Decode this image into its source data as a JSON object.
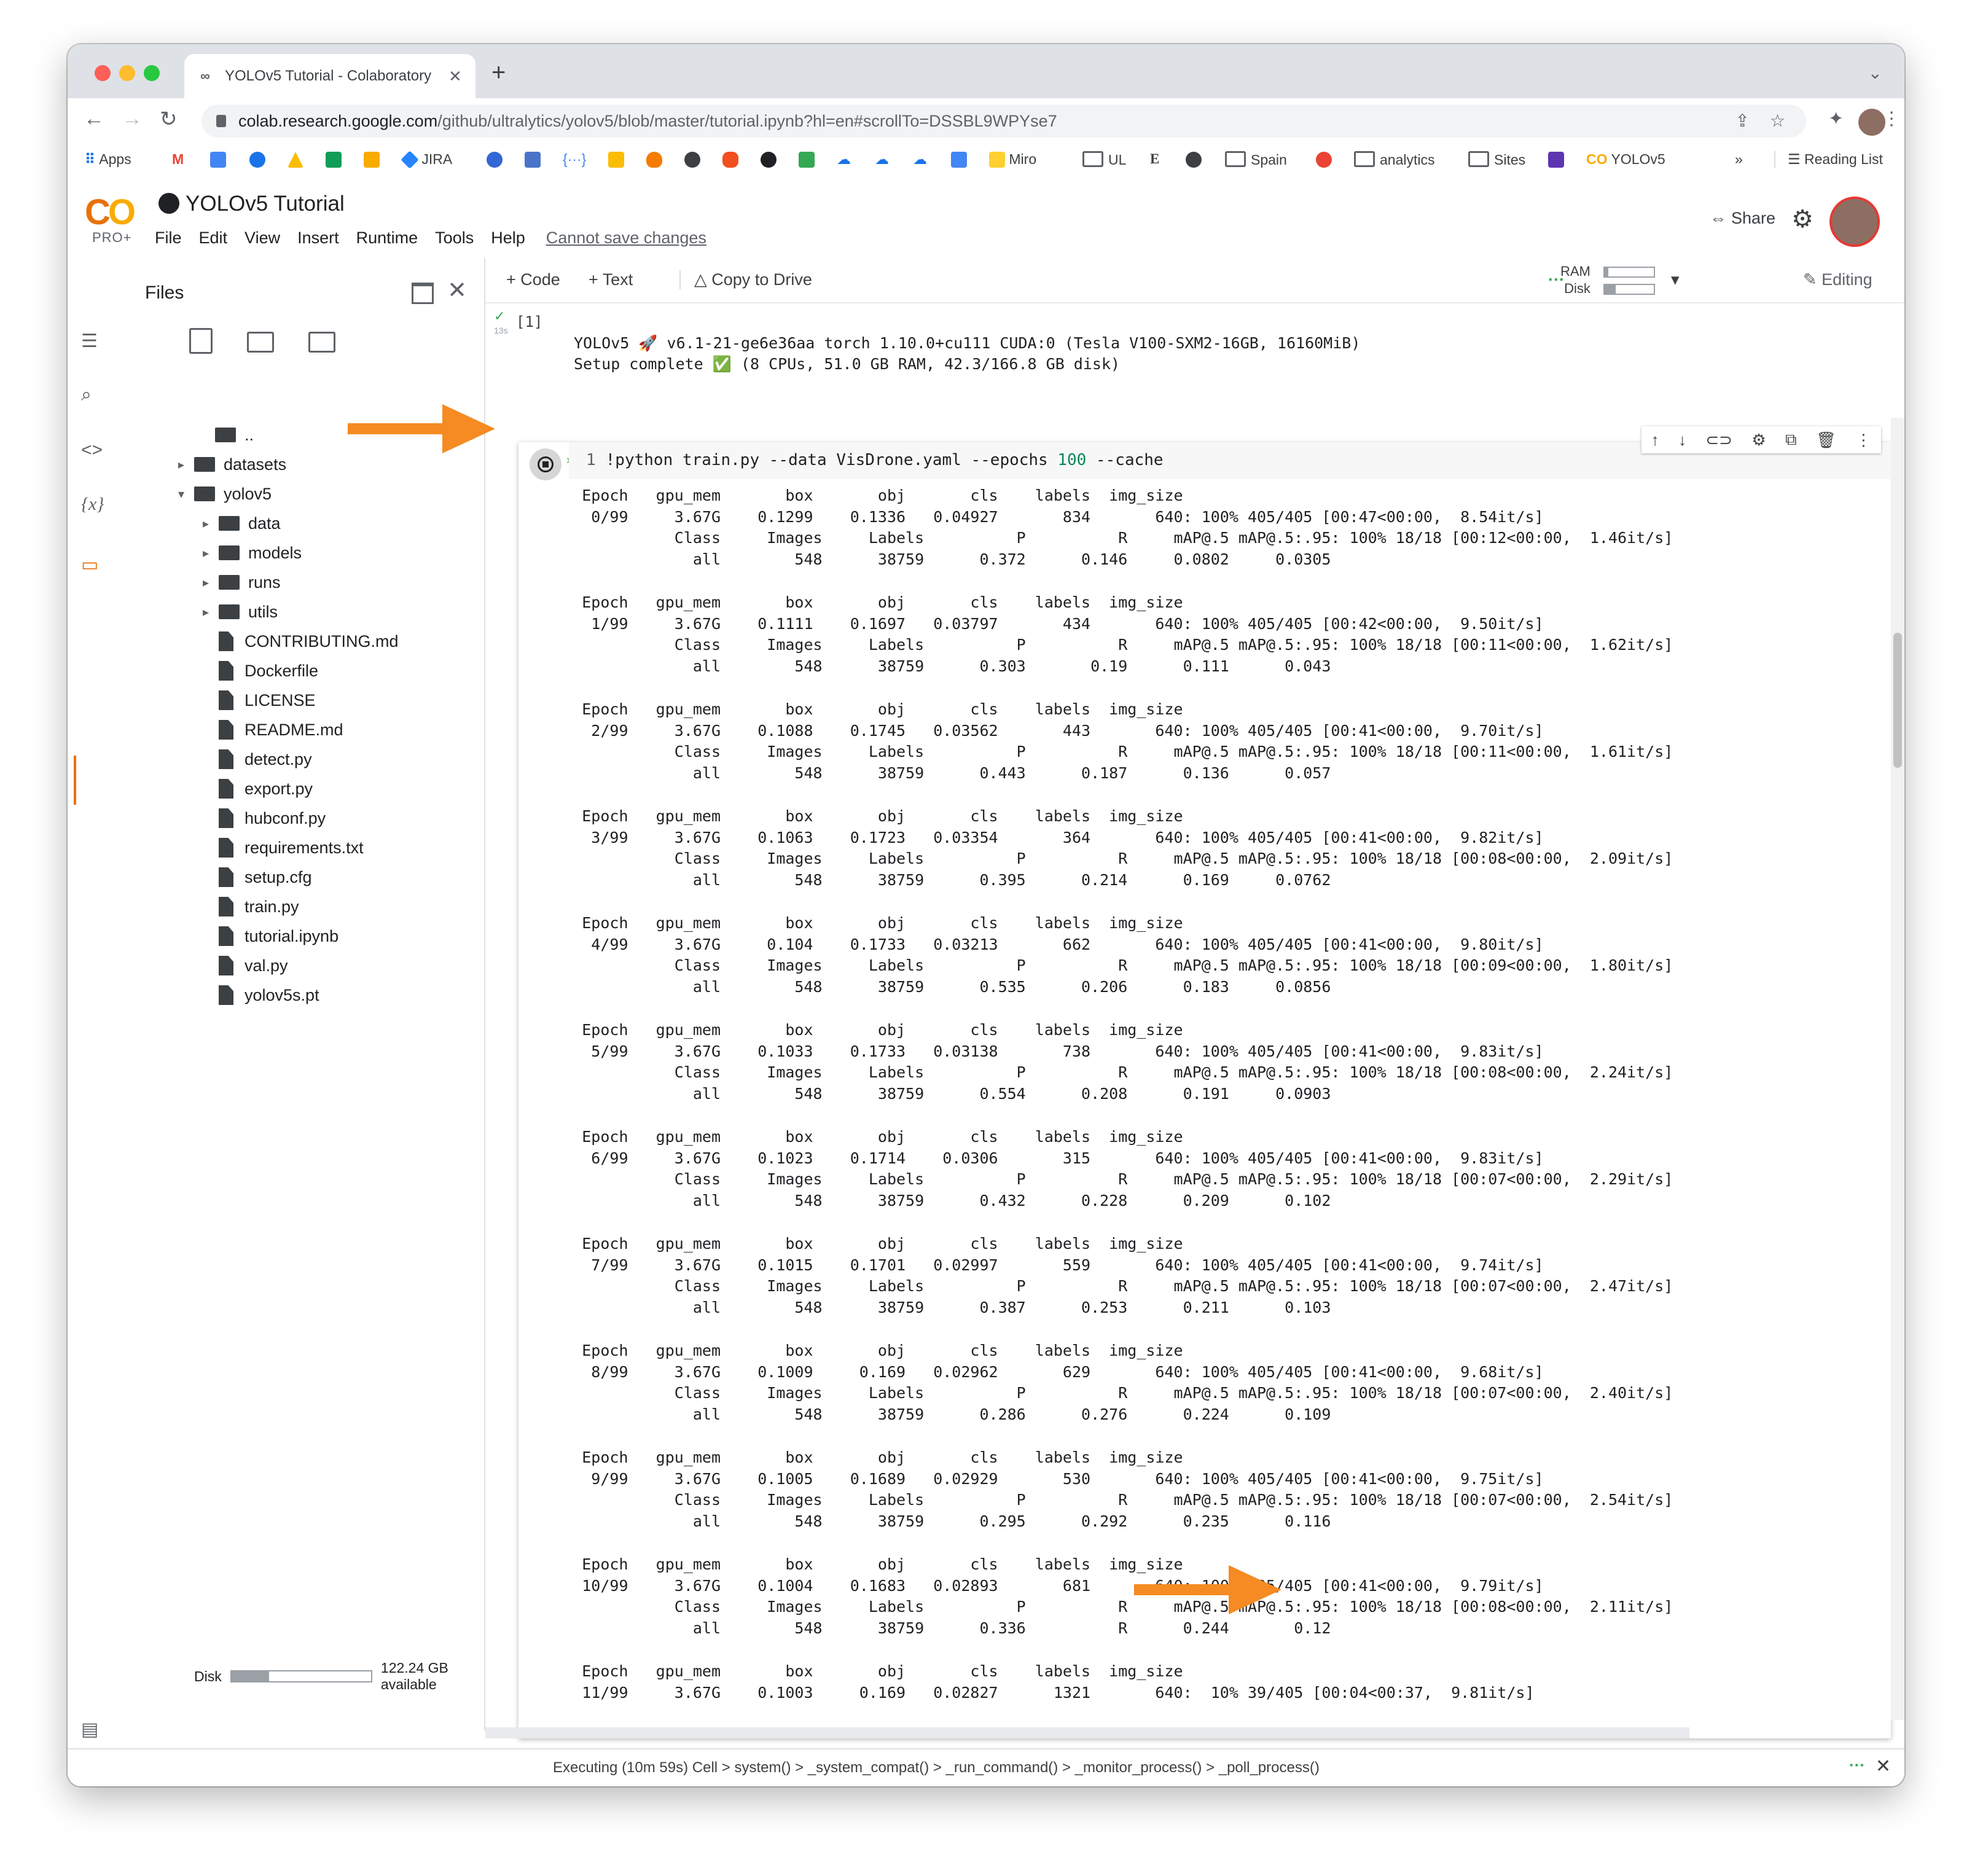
{
  "browser": {
    "tab_title": "YOLOv5 Tutorial - Colaboratory",
    "url_host": "colab.research.google.com",
    "url_path": "/github/ultralytics/yolov5/blob/master/tutorial.ipynb?hl=en#scrollTo=DSSBL9WPYse7",
    "bookmarks": [
      "Apps",
      "JIRA",
      "Miro",
      "UL",
      "Spain",
      "analytics",
      "Sites",
      "YOLOv5"
    ],
    "reading_list": "Reading List",
    "more": "»"
  },
  "colab": {
    "logo": "CO",
    "plan": "PRO+",
    "notebook_title": "YOLOv5 Tutorial",
    "menu": [
      "File",
      "Edit",
      "View",
      "Insert",
      "Runtime",
      "Tools",
      "Help"
    ],
    "cannot_save": "Cannot save changes",
    "share": "Share"
  },
  "toolbar": {
    "code": "+ Code",
    "text": "+ Text",
    "copy_drive": "Copy to Drive",
    "ram": "RAM",
    "disk": "Disk",
    "editing": "Editing",
    "ram_fill": 0.08,
    "disk_fill": 0.22
  },
  "files": {
    "title": "Files",
    "parent": "..",
    "tree": [
      {
        "name": "datasets",
        "type": "folder",
        "depth": 0,
        "caret": "▸"
      },
      {
        "name": "yolov5",
        "type": "folder",
        "depth": 0,
        "caret": "▾"
      },
      {
        "name": "data",
        "type": "folder",
        "depth": 1,
        "caret": "▸"
      },
      {
        "name": "models",
        "type": "folder",
        "depth": 1,
        "caret": "▸"
      },
      {
        "name": "runs",
        "type": "folder",
        "depth": 1,
        "caret": "▸"
      },
      {
        "name": "utils",
        "type": "folder",
        "depth": 1,
        "caret": "▸"
      },
      {
        "name": "CONTRIBUTING.md",
        "type": "file",
        "depth": 1
      },
      {
        "name": "Dockerfile",
        "type": "file",
        "depth": 1
      },
      {
        "name": "LICENSE",
        "type": "file",
        "depth": 1
      },
      {
        "name": "README.md",
        "type": "file",
        "depth": 1
      },
      {
        "name": "detect.py",
        "type": "file",
        "depth": 1
      },
      {
        "name": "export.py",
        "type": "file",
        "depth": 1
      },
      {
        "name": "hubconf.py",
        "type": "file",
        "depth": 1
      },
      {
        "name": "requirements.txt",
        "type": "file",
        "depth": 1
      },
      {
        "name": "setup.cfg",
        "type": "file",
        "depth": 1
      },
      {
        "name": "train.py",
        "type": "file",
        "depth": 1
      },
      {
        "name": "tutorial.ipynb",
        "type": "file",
        "depth": 1
      },
      {
        "name": "val.py",
        "type": "file",
        "depth": 1
      },
      {
        "name": "yolov5s.pt",
        "type": "file",
        "depth": 1
      }
    ],
    "disk_label": "Disk",
    "disk_available": "122.24 GB available",
    "disk_fill": 0.27
  },
  "cell1": {
    "prompt": "[1]",
    "elapsed": "13s",
    "output_lines": [
      "YOLOv5 🚀 v6.1-21-ge6e36aa torch 1.10.0+cu111 CUDA:0 (Tesla V100-SXM2-16GB, 16160MiB)",
      "Setup complete ✅ (8 CPUs, 51.0 GB RAM, 42.3/166.8 GB disk)"
    ]
  },
  "cell2": {
    "line_number": "1",
    "code_prefix": "!python train.py --data VisDrone.yaml --epochs ",
    "code_number": "100",
    "code_suffix": " --cache",
    "output_blocks": [
      [
        "     Epoch   gpu_mem       box       obj       cls    labels  img_size",
        "      0/99     3.67G    0.1299    0.1336   0.04927       834       640: 100% 405/405 [00:47<00:00,  8.54it/s]",
        "               Class     Images     Labels          P          R     mAP@.5 mAP@.5:.95: 100% 18/18 [00:12<00:00,  1.46it/s]",
        "                 all        548      38759      0.372      0.146     0.0802     0.0305"
      ],
      [
        "     Epoch   gpu_mem       box       obj       cls    labels  img_size",
        "      1/99     3.67G    0.1111    0.1697   0.03797       434       640: 100% 405/405 [00:42<00:00,  9.50it/s]",
        "               Class     Images     Labels          P          R     mAP@.5 mAP@.5:.95: 100% 18/18 [00:11<00:00,  1.62it/s]",
        "                 all        548      38759      0.303       0.19      0.111      0.043"
      ],
      [
        "     Epoch   gpu_mem       box       obj       cls    labels  img_size",
        "      2/99     3.67G    0.1088    0.1745   0.03562       443       640: 100% 405/405 [00:41<00:00,  9.70it/s]",
        "               Class     Images     Labels          P          R     mAP@.5 mAP@.5:.95: 100% 18/18 [00:11<00:00,  1.61it/s]",
        "                 all        548      38759      0.443      0.187      0.136      0.057"
      ],
      [
        "     Epoch   gpu_mem       box       obj       cls    labels  img_size",
        "      3/99     3.67G    0.1063    0.1723   0.03354       364       640: 100% 405/405 [00:41<00:00,  9.82it/s]",
        "               Class     Images     Labels          P          R     mAP@.5 mAP@.5:.95: 100% 18/18 [00:08<00:00,  2.09it/s]",
        "                 all        548      38759      0.395      0.214      0.169     0.0762"
      ],
      [
        "     Epoch   gpu_mem       box       obj       cls    labels  img_size",
        "      4/99     3.67G     0.104    0.1733   0.03213       662       640: 100% 405/405 [00:41<00:00,  9.80it/s]",
        "               Class     Images     Labels          P          R     mAP@.5 mAP@.5:.95: 100% 18/18 [00:09<00:00,  1.80it/s]",
        "                 all        548      38759      0.535      0.206      0.183     0.0856"
      ],
      [
        "     Epoch   gpu_mem       box       obj       cls    labels  img_size",
        "      5/99     3.67G    0.1033    0.1733   0.03138       738       640: 100% 405/405 [00:41<00:00,  9.83it/s]",
        "               Class     Images     Labels          P          R     mAP@.5 mAP@.5:.95: 100% 18/18 [00:08<00:00,  2.24it/s]",
        "                 all        548      38759      0.554      0.208      0.191     0.0903"
      ],
      [
        "     Epoch   gpu_mem       box       obj       cls    labels  img_size",
        "      6/99     3.67G    0.1023    0.1714    0.0306       315       640: 100% 405/405 [00:41<00:00,  9.83it/s]",
        "               Class     Images     Labels          P          R     mAP@.5 mAP@.5:.95: 100% 18/18 [00:07<00:00,  2.29it/s]",
        "                 all        548      38759      0.432      0.228      0.209      0.102"
      ],
      [
        "     Epoch   gpu_mem       box       obj       cls    labels  img_size",
        "      7/99     3.67G    0.1015    0.1701   0.02997       559       640: 100% 405/405 [00:41<00:00,  9.74it/s]",
        "               Class     Images     Labels          P          R     mAP@.5 mAP@.5:.95: 100% 18/18 [00:07<00:00,  2.47it/s]",
        "                 all        548      38759      0.387      0.253      0.211      0.103"
      ],
      [
        "     Epoch   gpu_mem       box       obj       cls    labels  img_size",
        "      8/99     3.67G    0.1009     0.169   0.02962       629       640: 100% 405/405 [00:41<00:00,  9.68it/s]",
        "               Class     Images     Labels          P          R     mAP@.5 mAP@.5:.95: 100% 18/18 [00:07<00:00,  2.40it/s]",
        "                 all        548      38759      0.286      0.276      0.224      0.109"
      ],
      [
        "     Epoch   gpu_mem       box       obj       cls    labels  img_size",
        "      9/99     3.67G    0.1005    0.1689   0.02929       530       640: 100% 405/405 [00:41<00:00,  9.75it/s]",
        "               Class     Images     Labels          P          R     mAP@.5 mAP@.5:.95: 100% 18/18 [00:07<00:00,  2.54it/s]",
        "                 all        548      38759      0.295      0.292      0.235      0.116"
      ],
      [
        "     Epoch   gpu_mem       box       obj       cls    labels  img_size",
        "     10/99     3.67G    0.1004    0.1683   0.02893       681       640: 100% 405/405 [00:41<00:00,  9.79it/s]",
        "               Class     Images     Labels          P          R     mAP@.5 mAP@.5:.95: 100% 18/18 [00:08<00:00,  2.11it/s]",
        "                 all        548      38759      0.336          R      0.244       0.12"
      ],
      [
        "     Epoch   gpu_mem       box       obj       cls    labels  img_size",
        "     11/99     3.67G    0.1003     0.169   0.02827      1321       640:  10% 39/405 [00:04<00:37,  9.81it/s]"
      ]
    ]
  },
  "status": {
    "text": "Executing (10m 59s)  Cell > system() > _system_compat() > _run_command() > _monitor_process() > _poll_process()",
    "dots": "···"
  },
  "colors": {
    "arrow": "#f58b22",
    "colab_orange": "#e8710a",
    "colab_yellow": "#f9ab00"
  }
}
